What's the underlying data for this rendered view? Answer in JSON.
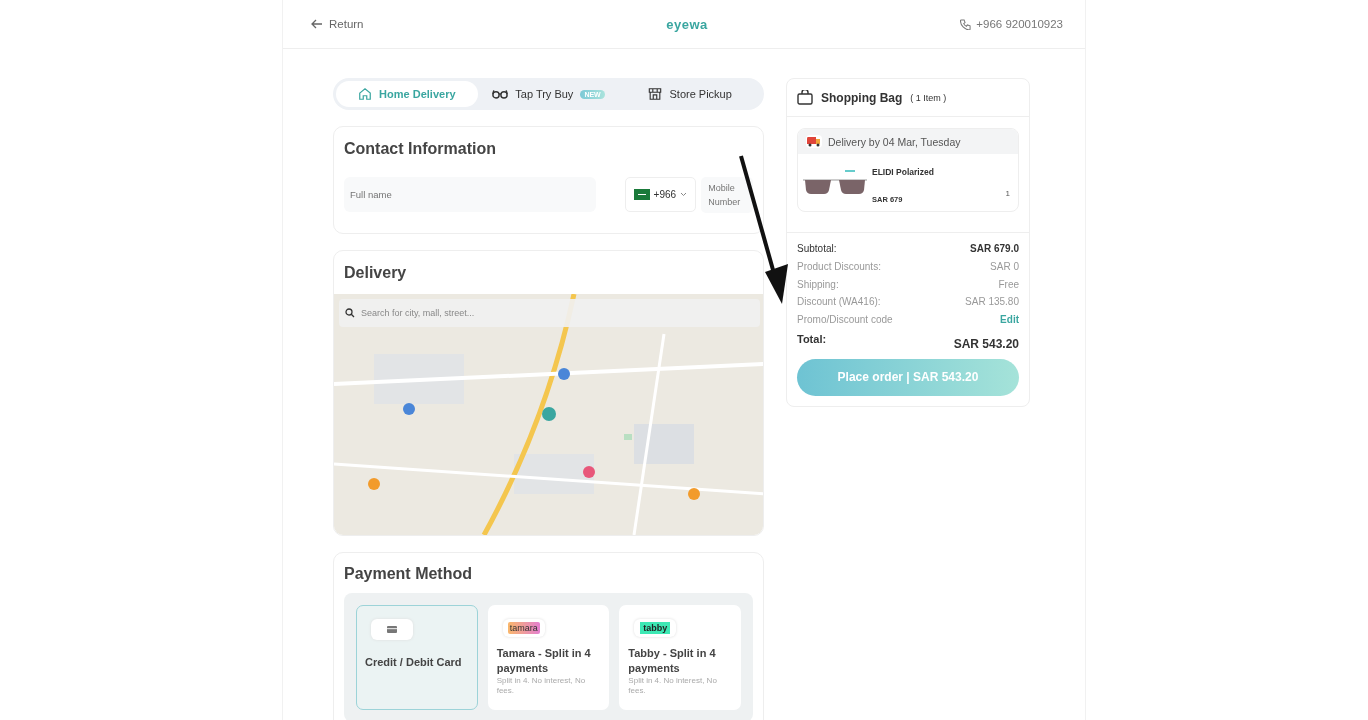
{
  "header": {
    "back_link": "Return",
    "logo": "eyewa",
    "phone": "+966 920010923"
  },
  "delivery_tabs": [
    {
      "label": "Home Delivery",
      "kind": "home",
      "selected": true
    },
    {
      "label": "Tap Try Buy",
      "kind": "glasses",
      "badge": "NEW",
      "selected": false
    },
    {
      "label": "Store Pickup",
      "kind": "store",
      "selected": false
    }
  ],
  "contact": {
    "title": "Contact Information",
    "full_name": {
      "placeholder": "Full name"
    },
    "country_code": "+966",
    "mobile": {
      "placeholder": "Mobile Number"
    }
  },
  "delivery": {
    "title": "Delivery",
    "search": {
      "placeholder": "Search for city, mall, street..."
    }
  },
  "payment": {
    "title": "Payment Method",
    "methods": [
      {
        "kind": "card",
        "title": "Credit / Debit Card",
        "selected": true
      },
      {
        "kind": "tamara",
        "logo": "tamara",
        "title": "Tamara - Split in 4 payments",
        "note": "Split in 4. No interest, No fees.",
        "selected": false
      },
      {
        "kind": "tabby",
        "logo": "tabby",
        "title": "Tabby - Split in 4 payments",
        "note": "Split in 4. No interest, No fees.",
        "selected": false
      }
    ]
  },
  "bag": {
    "title": "Shopping Bag",
    "count": "( 1 Item )",
    "delivery_note": "Delivery by 04 Mar, Tuesday",
    "items": [
      {
        "name": "ELIDI Polarized",
        "price": "SAR 679",
        "qty": "1"
      }
    ],
    "summary": [
      {
        "label": "Subtotal:",
        "value": "SAR 679.0",
        "kind": "strong"
      },
      {
        "label": "Product Discounts:",
        "value": "SAR 0",
        "kind": "muted"
      },
      {
        "label": "Shipping:",
        "value": "Free",
        "kind": "muted"
      },
      {
        "label": "Discount (WA416):",
        "value": "SAR 135.80",
        "kind": "muted"
      },
      {
        "label": "Promo/Discount code",
        "value": "Edit",
        "kind": "link"
      }
    ],
    "total_label": "Total:",
    "total": "SAR 543.20",
    "place_order": "Place order | SAR 543.20"
  },
  "annotation": {
    "kind": "arrow"
  }
}
